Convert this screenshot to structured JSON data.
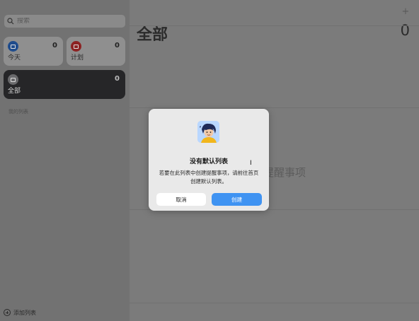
{
  "sidebar": {
    "search": {
      "placeholder": "搜索"
    },
    "cards": {
      "today": {
        "label": "今天",
        "count": "0"
      },
      "plan": {
        "label": "计划",
        "count": "0"
      },
      "all": {
        "label": "全部",
        "count": "0"
      }
    },
    "my_lists_label": "我的列表",
    "add_list_label": "添加列表"
  },
  "main": {
    "title": "全部",
    "count": "0",
    "add_icon": "plus-icon",
    "empty_text": "提醒事项"
  },
  "dialog": {
    "title": "没有默认列表",
    "message": "若要在此列表中创建提醒事项，请前往首页创建默认列表。",
    "cancel_label": "取消",
    "create_label": "创建",
    "accent": "#3f93f2"
  }
}
